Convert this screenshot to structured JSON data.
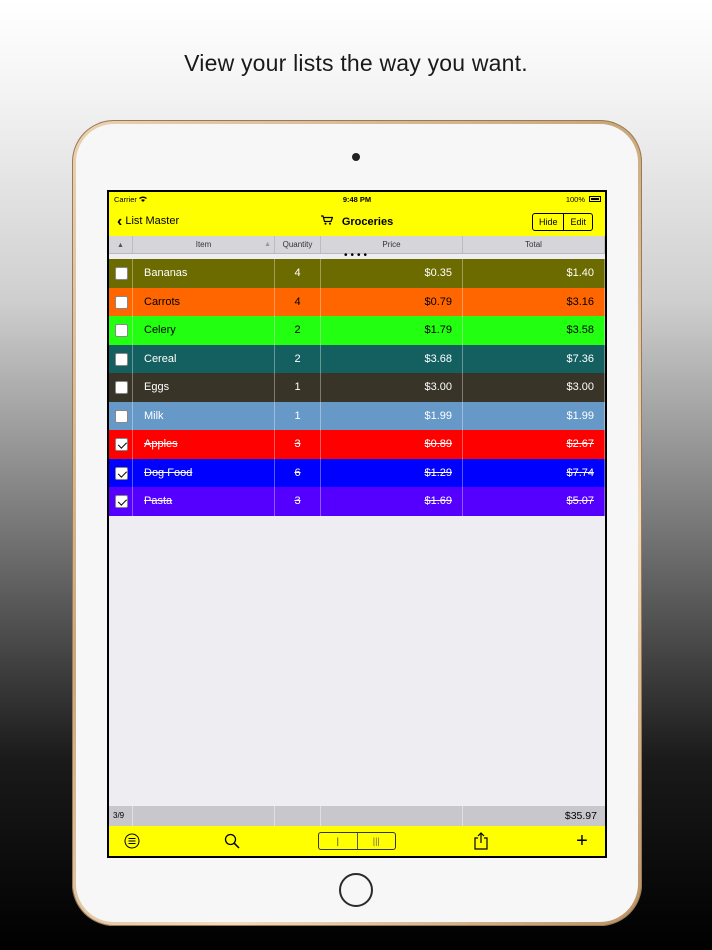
{
  "headline": "View your lists the way you want.",
  "status_bar": {
    "carrier": "Carrier",
    "time": "9:48 PM",
    "battery": "100%"
  },
  "nav": {
    "back_label": "List Master",
    "title": "Groceries",
    "hide_label": "Hide",
    "edit_label": "Edit"
  },
  "columns": {
    "item": "Item",
    "quantity": "Quantity",
    "price": "Price",
    "total": "Total"
  },
  "rows": [
    {
      "item": "Bananas",
      "quantity": "4",
      "price": "$0.35",
      "total": "$1.40",
      "checked": false,
      "bg": "#6b6b00",
      "fg": "#ffffff"
    },
    {
      "item": "Carrots",
      "quantity": "4",
      "price": "$0.79",
      "total": "$3.16",
      "checked": false,
      "bg": "#ff6600",
      "fg": "#000000"
    },
    {
      "item": "Celery",
      "quantity": "2",
      "price": "$1.79",
      "total": "$3.58",
      "checked": false,
      "bg": "#22ff11",
      "fg": "#000000"
    },
    {
      "item": "Cereal",
      "quantity": "2",
      "price": "$3.68",
      "total": "$7.36",
      "checked": false,
      "bg": "#146060",
      "fg": "#ffffff"
    },
    {
      "item": "Eggs",
      "quantity": "1",
      "price": "$3.00",
      "total": "$3.00",
      "checked": false,
      "bg": "#383428",
      "fg": "#ffffff"
    },
    {
      "item": "Milk",
      "quantity": "1",
      "price": "$1.99",
      "total": "$1.99",
      "checked": false,
      "bg": "#6699c8",
      "fg": "#ffffff"
    },
    {
      "item": "Apples",
      "quantity": "3",
      "price": "$0.89",
      "total": "$2.67",
      "checked": true,
      "bg": "#ff0000",
      "fg": "#ffffff"
    },
    {
      "item": "Dog Food",
      "quantity": "6",
      "price": "$1.29",
      "total": "$7.74",
      "checked": true,
      "bg": "#0000ff",
      "fg": "#ffffff"
    },
    {
      "item": "Pasta",
      "quantity": "3",
      "price": "$1.69",
      "total": "$5.07",
      "checked": true,
      "bg": "#5500ff",
      "fg": "#ffffff"
    }
  ],
  "footer": {
    "count": "3/9",
    "grand_total": "$35.97"
  },
  "toolbar": {
    "icons": [
      "list-icon",
      "search-icon",
      "layout-toggle",
      "share-icon",
      "add-icon"
    ],
    "add_label": "+"
  }
}
